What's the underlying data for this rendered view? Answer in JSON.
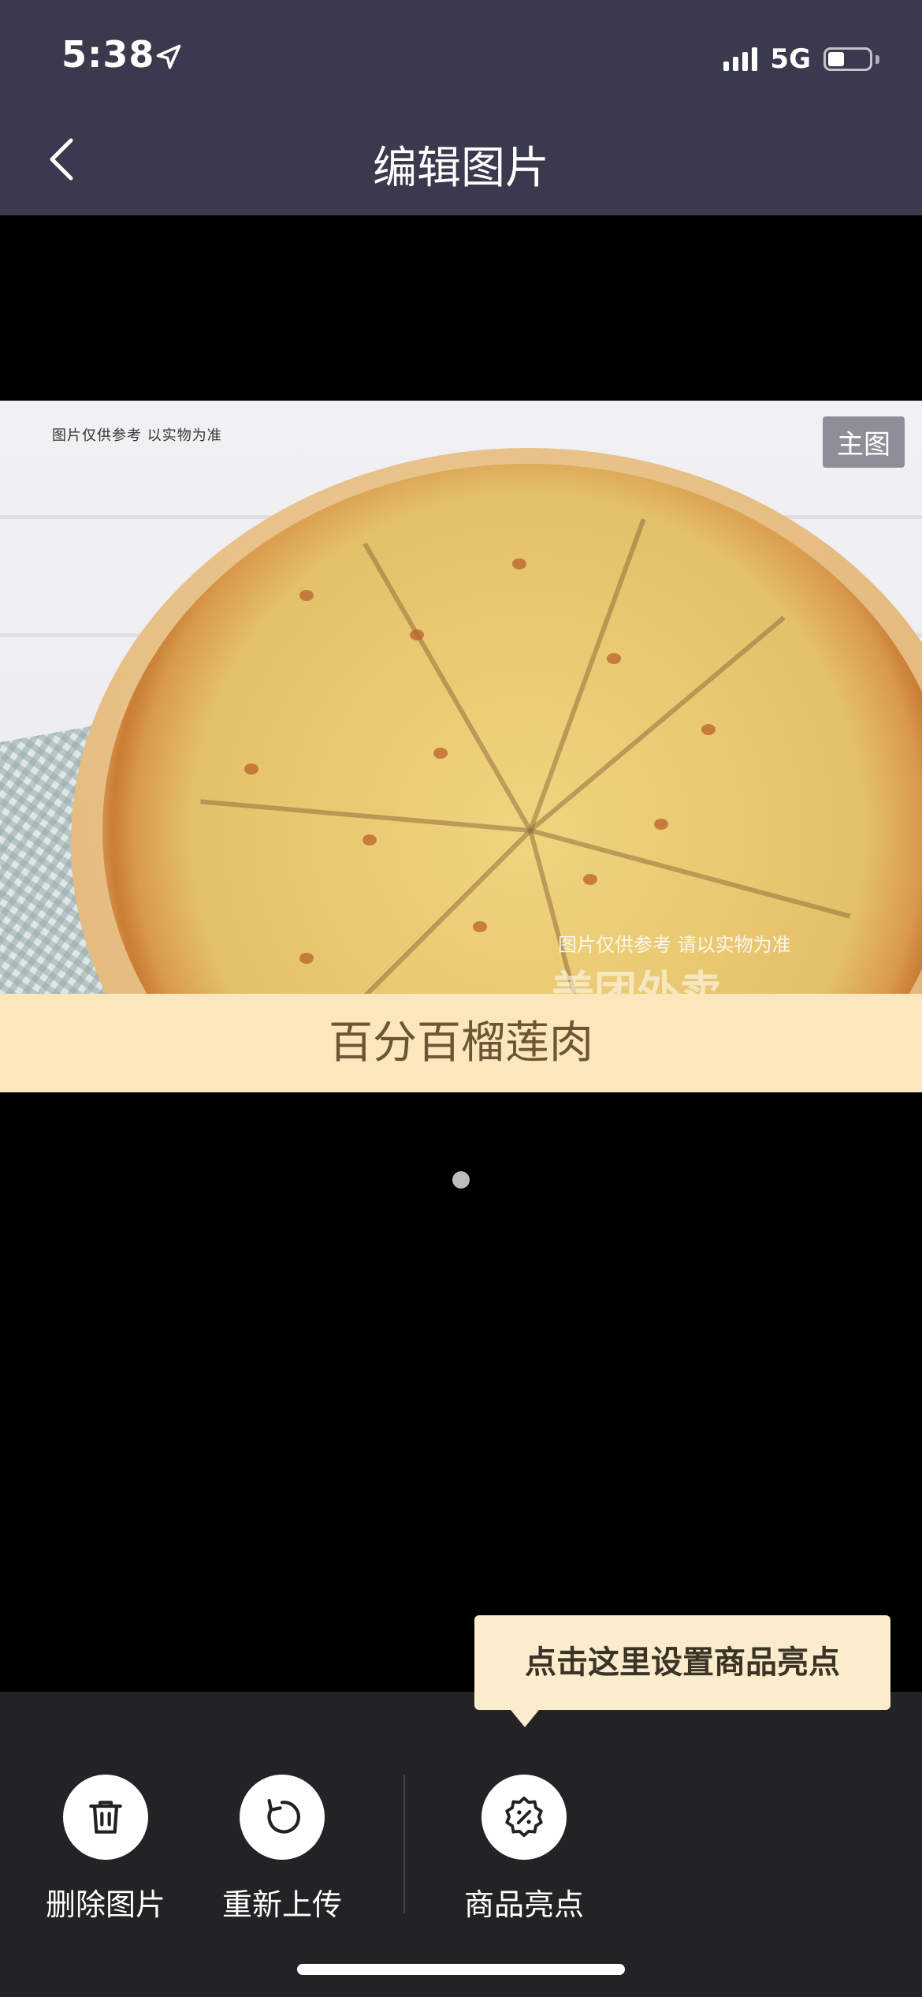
{
  "status_bar": {
    "time": "5:38",
    "network": "5G"
  },
  "header": {
    "title": "编辑图片"
  },
  "image": {
    "disclaimer": "图片仅供参考 以实物为准",
    "badge": "主图",
    "watermark_note": "图片仅供参考 请以实物为准",
    "watermark_brand": "美团外卖",
    "caption": "百分百榴莲肉"
  },
  "tooltip": {
    "text": "点击这里设置商品亮点"
  },
  "toolbar": {
    "delete_label": "删除图片",
    "reupload_label": "重新上传",
    "highlight_label": "商品亮点"
  },
  "colors": {
    "header_bg": "#393a4d",
    "caption_bg": "#fae7bc",
    "toolbar_bg": "#232325",
    "tooltip_bg": "#fbeccd"
  }
}
